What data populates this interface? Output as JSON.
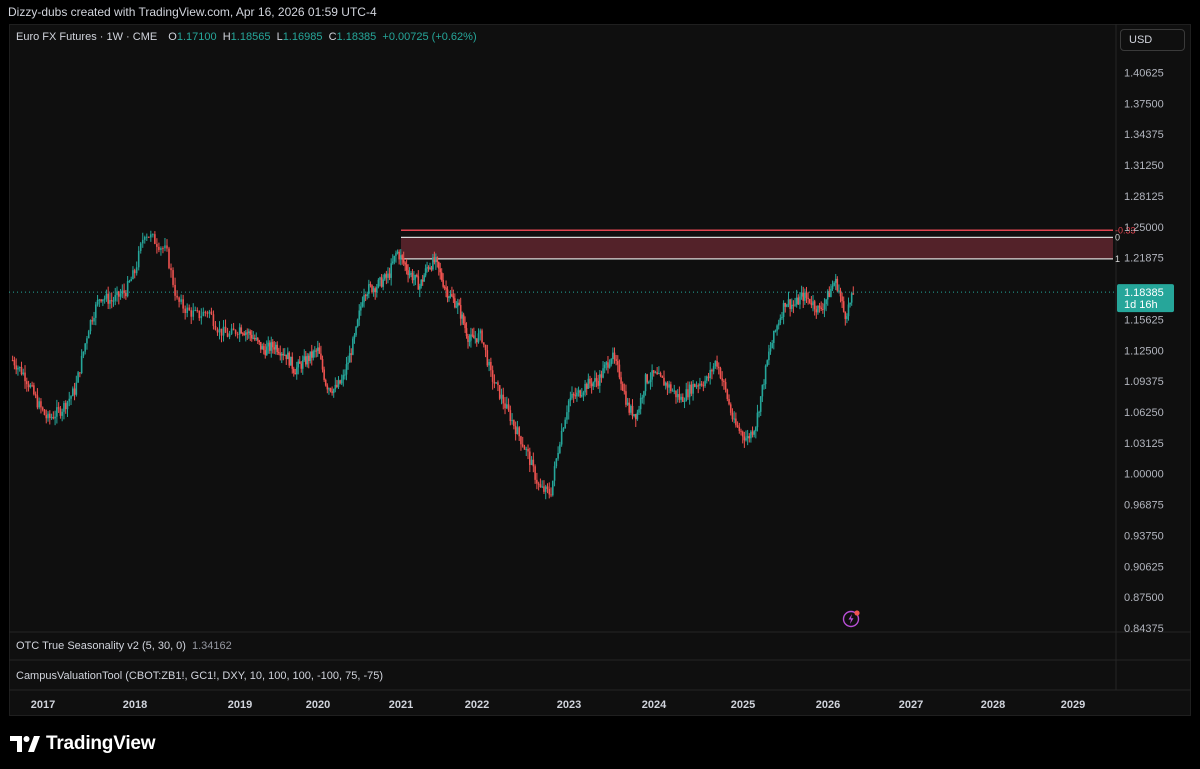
{
  "attribution": "Dizzy-dubs created with TradingView.com, Apr 16, 2026 01:59 UTC-4",
  "legend": {
    "symbol": "Euro FX Futures · 1W · CME",
    "open_label": "O",
    "open": "1.17100",
    "high_label": "H",
    "high": "1.18565",
    "low_label": "L",
    "low": "1.16985",
    "close_label": "C",
    "close": "1.18385",
    "change": "+0.00725 (+0.62%)"
  },
  "currency": "USD",
  "last_price": {
    "value": "1.18385",
    "countdown": "1d 16h"
  },
  "indicators": [
    {
      "name": "OTC True Seasonality v2 (5, 30, 0)",
      "value": "1.34162"
    },
    {
      "name": "CampusValuationTool (CBOT:ZB1!, GC1!, DXY, 10, 100, 100, -100, 75, -75)"
    }
  ],
  "brand": "TradingView",
  "colors": {
    "up": "#26a69a",
    "down": "#ef5350",
    "zone": "#6b2a33",
    "zone_line": "#e04450",
    "background": "#0f0f0f"
  },
  "chart_data": {
    "type": "candlestick",
    "instrument": "Euro FX Futures",
    "timeframe": "1W",
    "y_ticks": [
      "1.40625",
      "1.37500",
      "1.34375",
      "1.31250",
      "1.28125",
      "1.25000",
      "1.21875",
      "1.18385",
      "1.15625",
      "1.12500",
      "1.09375",
      "1.06250",
      "1.03125",
      "1.00000",
      "0.96875",
      "0.93750",
      "0.90625",
      "0.87500",
      "0.84375"
    ],
    "ylim": [
      0.84375,
      1.40625
    ],
    "x_ticks": [
      "2017",
      "2018",
      "2019",
      "2020",
      "2021",
      "2022",
      "2023",
      "2024",
      "2025",
      "2026",
      "2027",
      "2028",
      "2029"
    ],
    "xlim": [
      2016.66,
      2029.8
    ],
    "price_path": [
      [
        2016.67,
        1.115
      ],
      [
        2016.8,
        1.1
      ],
      [
        2016.95,
        1.07
      ],
      [
        2017.05,
        1.055
      ],
      [
        2017.2,
        1.065
      ],
      [
        2017.35,
        1.085
      ],
      [
        2017.5,
        1.15
      ],
      [
        2017.62,
        1.18
      ],
      [
        2017.75,
        1.175
      ],
      [
        2017.9,
        1.185
      ],
      [
        2018.0,
        1.205
      ],
      [
        2018.09,
        1.245
      ],
      [
        2018.2,
        1.235
      ],
      [
        2018.3,
        1.225
      ],
      [
        2018.4,
        1.175
      ],
      [
        2018.5,
        1.165
      ],
      [
        2018.6,
        1.16
      ],
      [
        2018.7,
        1.165
      ],
      [
        2018.8,
        1.145
      ],
      [
        2018.9,
        1.14
      ],
      [
        2019.0,
        1.148
      ],
      [
        2019.15,
        1.14
      ],
      [
        2019.3,
        1.125
      ],
      [
        2019.45,
        1.13
      ],
      [
        2019.6,
        1.12
      ],
      [
        2019.7,
        1.105
      ],
      [
        2019.85,
        1.115
      ],
      [
        2020.0,
        1.125
      ],
      [
        2020.1,
        1.09
      ],
      [
        2020.2,
        1.085
      ],
      [
        2020.3,
        1.095
      ],
      [
        2020.45,
        1.14
      ],
      [
        2020.55,
        1.185
      ],
      [
        2020.7,
        1.19
      ],
      [
        2020.85,
        1.2
      ],
      [
        2020.95,
        1.225
      ],
      [
        2021.1,
        1.205
      ],
      [
        2021.25,
        1.19
      ],
      [
        2021.35,
        1.21
      ],
      [
        2021.45,
        1.215
      ],
      [
        2021.6,
        1.185
      ],
      [
        2021.75,
        1.17
      ],
      [
        2021.9,
        1.135
      ],
      [
        2022.05,
        1.14
      ],
      [
        2022.15,
        1.1
      ],
      [
        2022.3,
        1.07
      ],
      [
        2022.45,
        1.04
      ],
      [
        2022.55,
        1.02
      ],
      [
        2022.68,
        0.985
      ],
      [
        2022.8,
        0.98
      ],
      [
        2022.9,
        1.035
      ],
      [
        2023.0,
        1.075
      ],
      [
        2023.1,
        1.08
      ],
      [
        2023.2,
        1.09
      ],
      [
        2023.35,
        1.095
      ],
      [
        2023.5,
        1.12
      ],
      [
        2023.6,
        1.1
      ],
      [
        2023.7,
        1.065
      ],
      [
        2023.8,
        1.06
      ],
      [
        2023.9,
        1.095
      ],
      [
        2024.0,
        1.1
      ],
      [
        2024.15,
        1.09
      ],
      [
        2024.3,
        1.075
      ],
      [
        2024.45,
        1.09
      ],
      [
        2024.6,
        1.095
      ],
      [
        2024.7,
        1.115
      ],
      [
        2024.8,
        1.085
      ],
      [
        2024.9,
        1.05
      ],
      [
        2025.05,
        1.035
      ],
      [
        2025.15,
        1.05
      ],
      [
        2025.3,
        1.12
      ],
      [
        2025.4,
        1.15
      ],
      [
        2025.5,
        1.175
      ],
      [
        2025.6,
        1.17
      ],
      [
        2025.7,
        1.18
      ],
      [
        2025.8,
        1.175
      ],
      [
        2025.9,
        1.165
      ],
      [
        2026.0,
        1.18
      ],
      [
        2026.08,
        1.195
      ],
      [
        2026.12,
        1.19
      ],
      [
        2026.2,
        1.16
      ],
      [
        2026.28,
        1.175
      ],
      [
        2026.31,
        1.18385
      ]
    ],
    "zone": {
      "x_start": 2021.0,
      "x_end": 2029.5,
      "levels": [
        {
          "label": "-0.33",
          "value": 1.2465
        },
        {
          "label": "0",
          "value": 1.2393
        },
        {
          "label": "1",
          "value": 1.2175
        }
      ]
    },
    "last_price_line": 1.18385
  }
}
